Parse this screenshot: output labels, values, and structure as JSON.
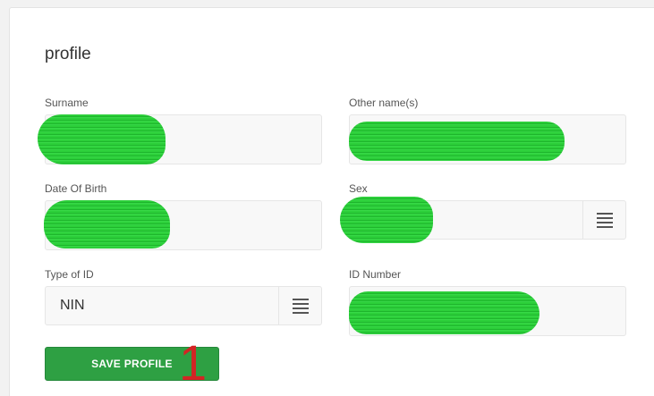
{
  "form": {
    "title": "profile",
    "surname": {
      "label": "Surname",
      "value": ""
    },
    "other_names": {
      "label": "Other name(s)",
      "value": ""
    },
    "date_of_birth": {
      "label": "Date Of Birth",
      "value": ""
    },
    "sex": {
      "label": "Sex",
      "value": ""
    },
    "type_of_id": {
      "label": "Type of ID",
      "value": "NIN"
    },
    "id_number": {
      "label": "ID Number",
      "value": ""
    },
    "save_label": "SAVE PROFILE"
  },
  "icons": {
    "select_menu": "hamburger-menu-icon"
  },
  "annotation": {
    "text": "1"
  },
  "colors": {
    "redaction": "#2ccf3a",
    "primary_button": "#2ea043",
    "annotation": "#d42424"
  }
}
